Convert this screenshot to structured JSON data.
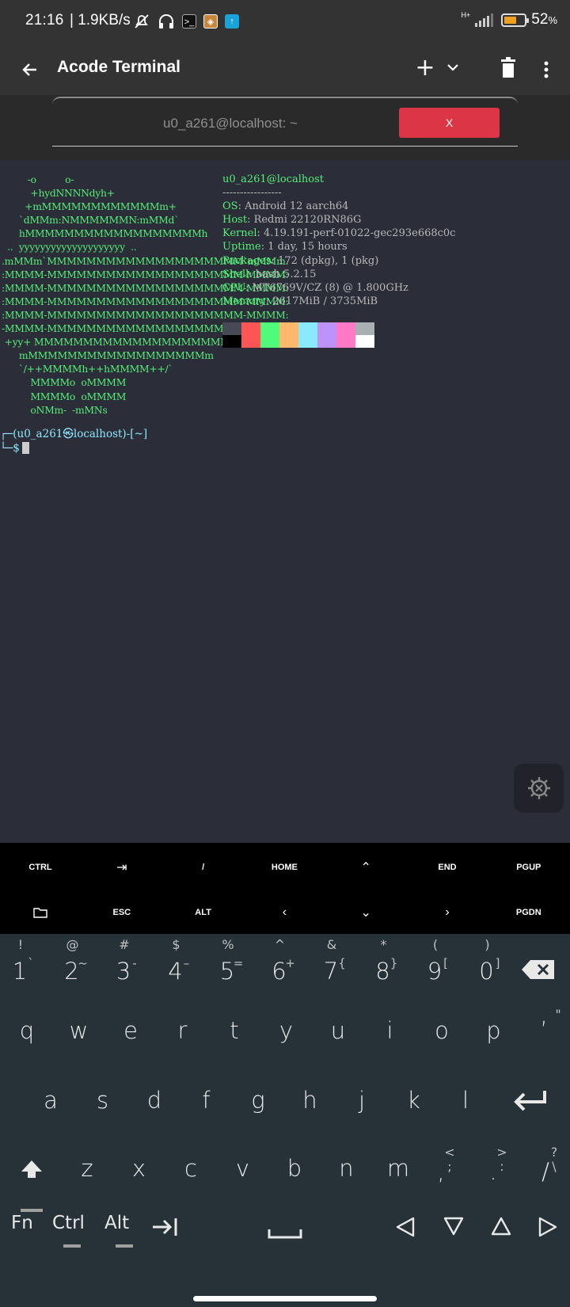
{
  "status_bar": {
    "time": "21:16",
    "net_speed": "| 1.9KB/s",
    "network_type": "H+",
    "battery": "52",
    "battery_unit": "%",
    "icons": [
      "mute-icon",
      "headphones-icon",
      "terminal-app-icon",
      "app-notification-icon",
      "upload-icon"
    ]
  },
  "app_bar": {
    "title": "Acode Terminal",
    "back_icon": "back-arrow-icon",
    "add_icon": "plus-icon",
    "dropdown_icon": "chevron-down-icon",
    "delete_icon": "trash-icon",
    "menu_icon": "more-vertical-icon"
  },
  "session_tab": {
    "label": "u0_a261@localhost: ~",
    "close_label": "X"
  },
  "terminal": {
    "logo_lines": [
      "         -o          o-",
      "          +hydNNNNdyh+",
      "        +mMMMMMMMMMMMMm+",
      "      `dMMm:NMMMMMMN:mMMd`",
      "      hMMMMMMMMMMMMMMMMMMh",
      "  ..  yyyyyyyyyyyyyyyyyyyy  ..",
      ".mMMm`MMMMMMMMMMMMMMMMMMMM`mMMm.",
      ":MMMM-MMMMMMMMMMMMMMMMMMMM-MMMM:",
      ":MMMM-MMMMMMMMMMMMMMMMMMMM-MMMM:",
      ":MMMM-MMMMMMMMMMMMMMMMMMMM-MMMM:",
      ":MMMM-MMMMMMMMMMMMMMMMMMMM-MMMM:",
      "-MMMM-MMMMMMMMMMMMMMMMMMMM-MMMM-",
      " +yy+ MMMMMMMMMMMMMMMMMMMM +yy+",
      "      mMMMMMMMMMMMMMMMMMMm",
      "      `/++MMMMh++hMMMM++/`",
      "          MMMMo  oMMMM",
      "          MMMMo  oMMMM",
      "          oNMm-  -mMNs"
    ],
    "user_host": "u0_a261@localhost",
    "separator": "-----------------",
    "info": [
      {
        "key": "OS",
        "value": ": Android 12 aarch64"
      },
      {
        "key": "Host",
        "value": ": Redmi 22120RN86G"
      },
      {
        "key": "Kernel",
        "value": ": 4.19.191-perf-01022-gec293e668c0c"
      },
      {
        "key": "Uptime",
        "value": ": 1 day, 15 hours"
      },
      {
        "key": "Packages",
        "value": ": 172 (dpkg), 1 (pkg)"
      },
      {
        "key": "Shell",
        "value": ": bash 5.2.15"
      },
      {
        "key": "CPU",
        "value": ": MT6769V/CZ (8) @ 1.800GHz"
      },
      {
        "key": "Memory",
        "value": ": 2617MiB / 3735MiB"
      }
    ],
    "palette_top": [
      "#474a56",
      "#ff5555",
      "#50fa7b",
      "#ffb86c",
      "#8be9fd",
      "#bd93f9",
      "#ff79c6",
      "#a8b0b4"
    ],
    "palette_bottom": [
      "#000000",
      "#ff5555",
      "#50fa7b",
      "#ffb86c",
      "#8be9fd",
      "#bd93f9",
      "#ff79c6",
      "#ffffff"
    ],
    "prompt_line1": "┌─(u0_a261㉿localhost)-[~]",
    "prompt_line2": "└─$",
    "settings_icon": "settings-gear-icon"
  },
  "extra_keys": {
    "row1": [
      "CTRL",
      "⇥",
      "/",
      "HOME",
      "⌃",
      "END",
      "PGUP"
    ],
    "row2": [
      "📁",
      "ESC",
      "ALT",
      "‹",
      "⌄",
      "›",
      "PGDN"
    ]
  },
  "keyboard": {
    "number_row": [
      {
        "key": "1",
        "sub": "`",
        "hint": "!"
      },
      {
        "key": "2",
        "sub": "~",
        "hint": "@"
      },
      {
        "key": "3",
        "sub": "-",
        "hint": "#"
      },
      {
        "key": "4",
        "sub": "–",
        "hint": "$"
      },
      {
        "key": "5",
        "sub": "=",
        "hint": "%"
      },
      {
        "key": "6",
        "sub": "+",
        "hint": "^"
      },
      {
        "key": "7",
        "sub": "{",
        "hint": "&"
      },
      {
        "key": "8",
        "sub": "}",
        "hint": "*"
      },
      {
        "key": "9",
        "sub": "[",
        "hint": "("
      },
      {
        "key": "0",
        "sub": "]",
        "hint": ")"
      }
    ],
    "row_q": [
      "q",
      "w",
      "e",
      "r",
      "t",
      "y",
      "u",
      "i",
      "o",
      "p"
    ],
    "row_a": [
      "a",
      "s",
      "d",
      "f",
      "g",
      "h",
      "j",
      "k",
      "l"
    ],
    "row_z": [
      "z",
      "x",
      "c",
      "v",
      "b",
      "n",
      "m"
    ],
    "punct": [
      {
        "key": ",",
        "hint": "<",
        "sub": ";"
      },
      {
        "key": ".",
        "hint": ">",
        "sub": ":"
      },
      {
        "key": "/",
        "hint": "?",
        "sub": "\\"
      }
    ],
    "quote_hint": "\"",
    "quote_key": "’",
    "mods": [
      "Fn",
      "Ctrl",
      "Alt"
    ],
    "tab_icon": "tab-key-icon",
    "backspace_icon": "backspace-icon",
    "enter_icon": "enter-icon",
    "shift_icon": "shift-icon",
    "space_icon": "space-icon",
    "arrow_icons": [
      "arrow-left-icon",
      "arrow-down-icon",
      "arrow-up-icon",
      "arrow-right-icon"
    ]
  }
}
